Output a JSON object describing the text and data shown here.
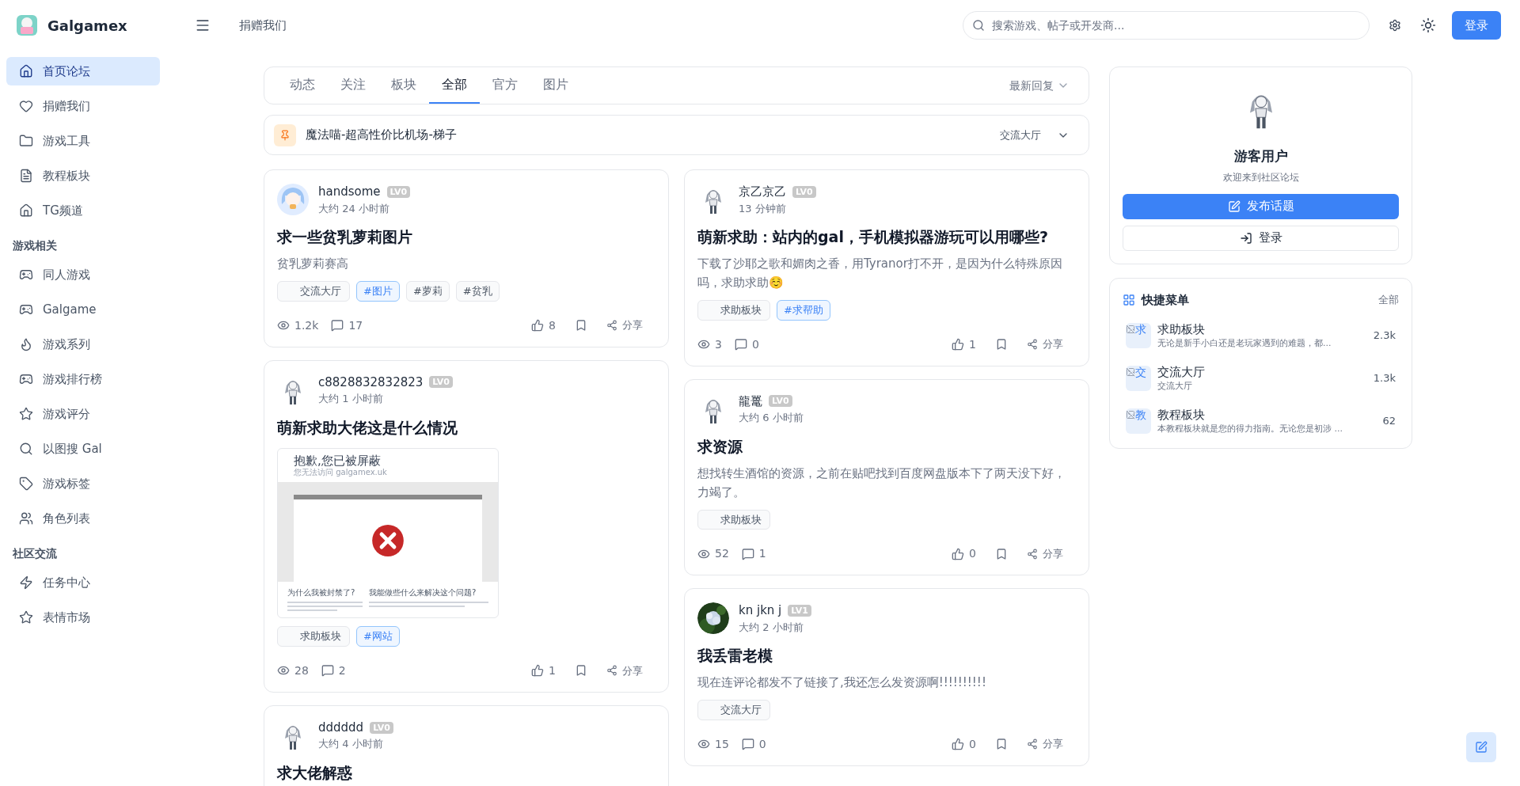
{
  "brand": {
    "name": "Galgamex"
  },
  "header": {
    "link": "捐赠我们",
    "search": {
      "placeholder": "搜索游戏、帖子或开发商..."
    },
    "login": "登录"
  },
  "sidebar": {
    "items": [
      {
        "label": "首页论坛",
        "selected": true
      },
      {
        "label": "捐赠我们",
        "selected": false
      },
      {
        "label": "游戏工具",
        "selected": false
      },
      {
        "label": "教程板块",
        "selected": false
      },
      {
        "label": "TG频道",
        "selected": false
      }
    ],
    "sections": [
      {
        "title": "游戏相关",
        "items": [
          {
            "label": "同人游戏",
            "selected": false
          },
          {
            "label": "Galgame",
            "selected": false
          },
          {
            "label": "游戏系列",
            "selected": false
          },
          {
            "label": "游戏排行榜",
            "selected": false
          },
          {
            "label": "游戏评分",
            "selected": false
          },
          {
            "label": "以图搜 Gal",
            "selected": false
          },
          {
            "label": "游戏标签",
            "selected": false
          },
          {
            "label": "角色列表",
            "selected": false
          }
        ]
      },
      {
        "title": "社区交流",
        "items": [
          {
            "label": "任务中心",
            "selected": false
          },
          {
            "label": "表情市场",
            "selected": false
          }
        ]
      }
    ]
  },
  "tabs": [
    {
      "label": "动态",
      "selected": false
    },
    {
      "label": "关注",
      "selected": false
    },
    {
      "label": "板块",
      "selected": false
    },
    {
      "label": "全部",
      "selected": true
    },
    {
      "label": "官方",
      "selected": false
    },
    {
      "label": "图片",
      "selected": false
    }
  ],
  "sort": {
    "label": "最新回复"
  },
  "pinned": {
    "title": "魔法喵-超高性价比机场-梯子",
    "board": "交流大厅"
  },
  "post_columns": [
    {
      "posts": [
        {
          "kind": "color",
          "user": "handsome",
          "badge": "LV0",
          "time": "大约 24 小时前",
          "title": "求一些贫乳萝莉图片",
          "excerpt": "贫乳萝莉赛高",
          "tags": [
            {
              "kind": "category",
              "label": "交流大厅"
            },
            {
              "kind": "tag",
              "label": "#图片",
              "color": "#3b82f6"
            },
            {
              "kind": "tag",
              "label": "#萝莉",
              "color": "#4b5563"
            },
            {
              "kind": "tag",
              "label": "#贫乳",
              "color": "#4b5563"
            }
          ],
          "views": "1.2k",
          "comments": "17",
          "likes": "8",
          "share": "分享"
        },
        {
          "kind": "sketch",
          "user": "c8828832832823",
          "badge": "LV0",
          "time": "大约 1 小时前",
          "title": "萌新求助大佬这是什么情况",
          "image": {
            "kind": "screenshot",
            "heading": "抱歉,您已被屏蔽",
            "subheading": "您无法访问 galgamex.uk",
            "left_title": "为什么我被封禁了?",
            "right_title": "我能做些什么来解决这个问题?"
          },
          "tags": [
            {
              "kind": "category",
              "label": "求助板块"
            },
            {
              "kind": "tag",
              "label": "#网站",
              "color": "#3b82f6"
            }
          ],
          "views": "28",
          "comments": "2",
          "likes": "1",
          "share": "分享"
        },
        {
          "kind": "sketch",
          "user": "dddddd",
          "badge": "LV0",
          "time": "大约 4 小时前",
          "title": "求大佬解惑"
        }
      ]
    },
    {
      "posts": [
        {
          "kind": "sketch",
          "user": "京乙京乙",
          "badge": "LV0",
          "time": "13 分钟前",
          "title": "萌新求助：站内的gal，手机模拟器游玩可以用哪些?",
          "excerpt": "下载了沙耶之歌和媚肉之香，用Tyranor打不开，是因为什么特殊原因吗，求助求助☺️",
          "tags": [
            {
              "kind": "category",
              "label": "求助板块"
            },
            {
              "kind": "tag",
              "label": "#求帮助",
              "color": "#3b82f6"
            }
          ],
          "views": "3",
          "comments": "0",
          "likes": "1",
          "share": "分享"
        },
        {
          "kind": "sketch",
          "user": "龍鼍",
          "badge": "LV0",
          "time": "大约 6 小时前",
          "title": "求资源",
          "excerpt": "想找转生酒馆的资源，之前在贴吧找到百度网盘版本下了两天没下好，力竭了。",
          "tags": [
            {
              "kind": "category",
              "label": "求助板块"
            }
          ],
          "views": "52",
          "comments": "1",
          "likes": "0",
          "share": "分享"
        },
        {
          "kind": "photo",
          "user": "kn jkn j",
          "badge": "LV1",
          "time": "大约 2 小时前",
          "title": "我丢雷老模",
          "excerpt": "现在连评论都发不了链接了,我还怎么发资源啊!!!!!!!!!!",
          "tags": [
            {
              "kind": "category",
              "label": "交流大厅"
            }
          ],
          "views": "15",
          "comments": "0",
          "likes": "0",
          "share": "分享"
        }
      ]
    }
  ],
  "profile": {
    "name": "游客用户",
    "subtitle": "欢迎来到社区论坛",
    "post_button": "发布话题",
    "login_button": "登录"
  },
  "quick_menu": {
    "title": "快捷菜单",
    "all": "全部",
    "items": [
      {
        "image_alt": "求",
        "title": "求助板块",
        "description": "无论是新手小白还是老玩家遇到的难题，都...",
        "count": "2.3k"
      },
      {
        "image_alt": "交",
        "title": "交流大厅",
        "description": "交流大厅",
        "count": "1.3k"
      },
      {
        "image_alt": "教",
        "title": "教程板块",
        "description": "本教程板块就是您的得力指南。无论您是初涉 ...",
        "count": "62"
      }
    ]
  }
}
